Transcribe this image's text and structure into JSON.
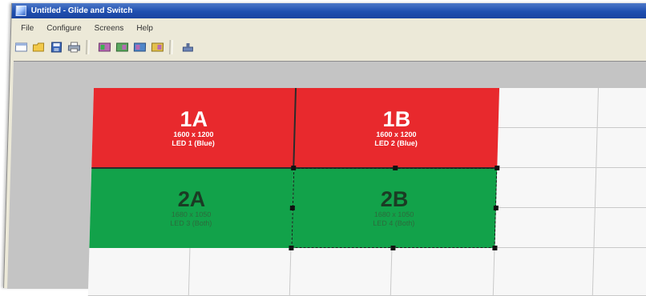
{
  "window": {
    "title": "Untitled - Glide and Switch",
    "accent": "#1f4fb0"
  },
  "menu": {
    "items": [
      {
        "label": "File"
      },
      {
        "label": "Configure"
      },
      {
        "label": "Screens"
      },
      {
        "label": "Help"
      }
    ]
  },
  "toolbar": {
    "buttons": [
      {
        "icon": "new-icon"
      },
      {
        "icon": "open-icon"
      },
      {
        "icon": "save-icon"
      },
      {
        "icon": "print-icon"
      },
      {
        "icon": "layout-1-icon"
      },
      {
        "icon": "layout-2-icon"
      },
      {
        "icon": "layout-3-icon"
      },
      {
        "icon": "layout-4-icon"
      },
      {
        "icon": "send-icon"
      }
    ]
  },
  "screens": [
    {
      "id": "1A",
      "resolution": "1600 x 1200",
      "led": "LED 1 (Blue)",
      "color": "#e8292d",
      "selected": false
    },
    {
      "id": "1B",
      "resolution": "1600 x 1200",
      "led": "LED 2 (Blue)",
      "color": "#e8292d",
      "selected": false
    },
    {
      "id": "2A",
      "resolution": "1680 x 1050",
      "led": "LED 3 (Both)",
      "color": "#12a24a",
      "selected": false
    },
    {
      "id": "2B",
      "resolution": "1680 x 1050",
      "led": "LED 4 (Both)",
      "color": "#12a24a",
      "selected": true
    }
  ]
}
